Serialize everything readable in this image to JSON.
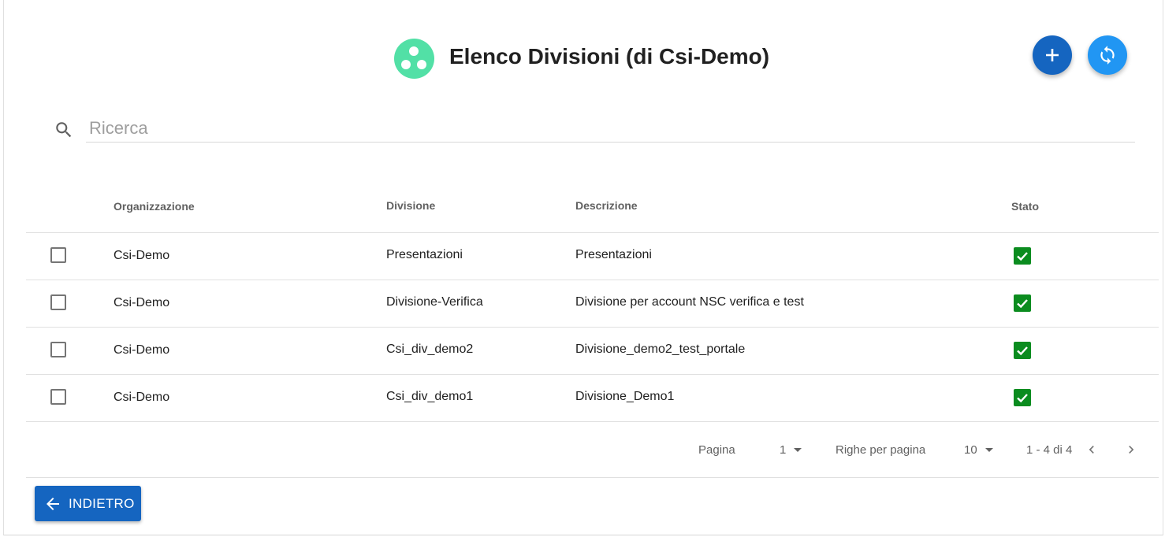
{
  "header": {
    "title": "Elenco Divisioni (di Csi-Demo)",
    "icon": "divisions-icon",
    "add_button_icon": "plus-icon",
    "refresh_button_icon": "refresh-icon"
  },
  "search": {
    "placeholder": "Ricerca",
    "value": ""
  },
  "table": {
    "columns": [
      "Organizzazione",
      "Divisione",
      "Descrizione",
      "Stato"
    ],
    "rows": [
      {
        "organizzazione": "Csi-Demo",
        "divisione": "Presentazioni",
        "descrizione": "Presentazioni",
        "stato": true
      },
      {
        "organizzazione": "Csi-Demo",
        "divisione": "Divisione-Verifica",
        "descrizione": "Divisione per account NSC verifica e test",
        "stato": true
      },
      {
        "organizzazione": "Csi-Demo",
        "divisione": "Csi_div_demo2",
        "descrizione": "Divisione_demo2_test_portale",
        "stato": true
      },
      {
        "organizzazione": "Csi-Demo",
        "divisione": "Csi_div_demo1",
        "descrizione": "Divisione_Demo1",
        "stato": true
      }
    ]
  },
  "pagination": {
    "page_label": "Pagina",
    "page_value": "1",
    "rows_per_page_label": "Righe per pagina",
    "rows_per_page_value": "10",
    "range_text": "1 - 4 di 4"
  },
  "footer": {
    "back_label": "INDIETRO"
  },
  "colors": {
    "primary": "#1565c0",
    "refresh": "#2196f3",
    "header_icon": "#52e0a6",
    "status_ok": "#0b8c1f"
  }
}
